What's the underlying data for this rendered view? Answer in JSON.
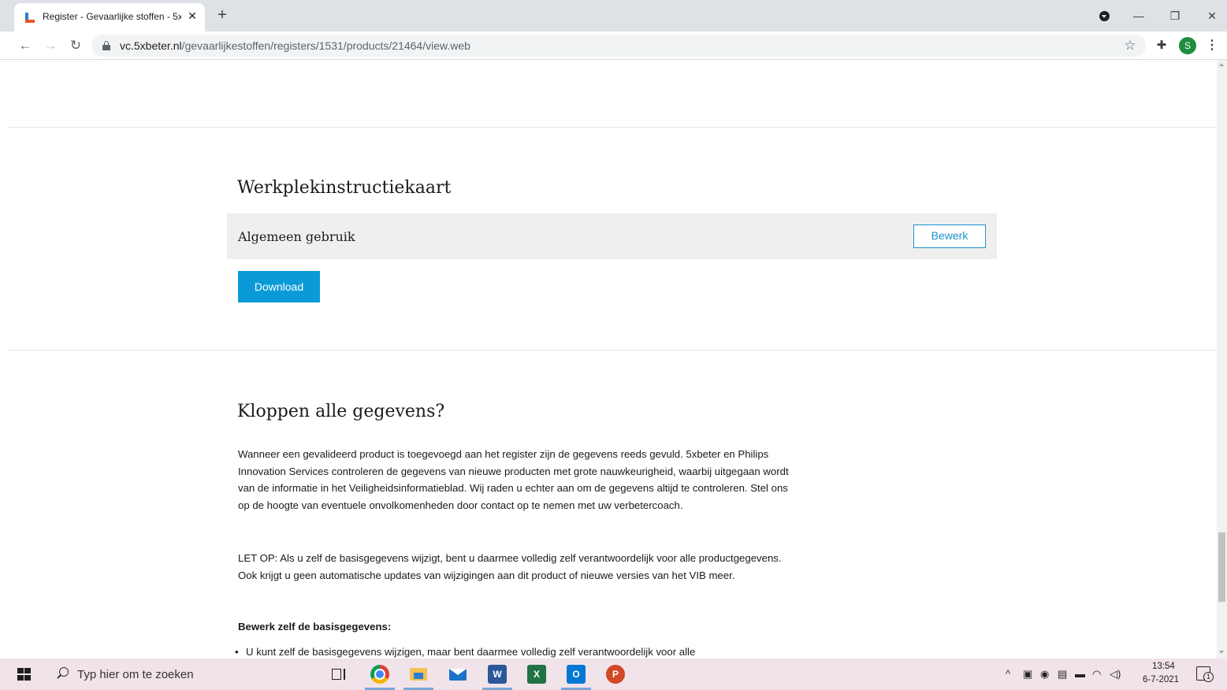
{
  "browser": {
    "tab_title": "Register - Gevaarlijke stoffen - 5x",
    "new_tab_label": "+",
    "url_host": "vc.5xbeter.nl",
    "url_path": "/gevaarlijkestoffen/registers/1531/products/21464/view.web",
    "profile_initial": "S"
  },
  "page": {
    "wpik_title": "Werkplekinstructiekaart",
    "wpik_row_label": "Algemeen gebruik",
    "edit_button_label": "Bewerk",
    "download_button_label": "Download",
    "verify_title": "Kloppen alle gegevens?",
    "paragraph_1": "Wanneer een gevalideerd product is toegevoegd aan het register zijn de gegevens reeds gevuld. 5xbeter en Philips Innovation Services controleren de gegevens van nieuwe producten met grote nauwkeurigheid, waarbij uitgegaan wordt van de informatie in het Veiligheidsinformatieblad. Wij raden u echter aan om de gegevens altijd te controleren. Stel ons op de hoogte van eventuele onvolkomenheden door contact op te nemen met uw verbetercoach.",
    "paragraph_2": "LET OP: Als u zelf de basisgegevens wijzigt, bent u daarmee volledig zelf verantwoordelijk voor alle productgegevens. Ook krijgt u geen automatische updates van wijzigingen aan dit product of nieuwe versies van het VIB meer.",
    "edit_basics_heading": "Bewerk zelf de basisgegevens:",
    "bullet_1": "U kunt zelf de basisgegevens wijzigen, maar bent daarmee volledig zelf verantwoordelijk voor alle"
  },
  "taskbar": {
    "search_placeholder": "Typ hier om te zoeken",
    "clock_time": "13:54",
    "clock_date": "6-7-2021",
    "notification_count": "1"
  },
  "colors": {
    "accent": "#0b9ad8",
    "button_outline": "#1a93cf",
    "row_background": "#efefef"
  }
}
